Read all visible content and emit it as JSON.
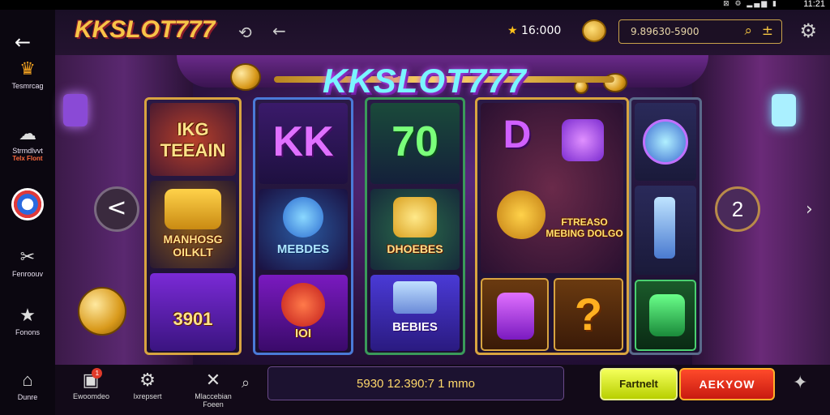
{
  "statusbar": {
    "time": "11:21",
    "icons": "⊠ ⚙ ▂▄▆ ▮"
  },
  "sidebar": {
    "items": [
      {
        "label": "Tesmrcag",
        "icon": "trophy-icon",
        "glyph": "🏆"
      },
      {
        "label": "Strmdlvvt",
        "sub": "Telx Flont",
        "icon": "cloud-icon",
        "glyph": "☁"
      },
      {
        "label": "",
        "icon": "poker-chip-icon",
        "glyph": "●"
      },
      {
        "label": "Fenroouv",
        "icon": "tools-icon",
        "glyph": "✕"
      },
      {
        "label": "Fonons",
        "icon": "star-icon",
        "glyph": "★"
      }
    ]
  },
  "header": {
    "logo": "KKSLOT777",
    "balance": "16:000",
    "search_text": "9.89630-5900"
  },
  "stage": {
    "banner_title": "KKSLOT777",
    "left_nav": "<",
    "right_nav": "2"
  },
  "reels": {
    "r1": {
      "top": "IKG TEEAIN",
      "mid": "MANHOSG OILKLT",
      "bottom": "3901"
    },
    "r2": {
      "top": "KK",
      "mid": "MEBDES",
      "bottom": "IOI"
    },
    "r3": {
      "top": "70",
      "mid": "DHOEBES",
      "bottom": "BEBIES"
    },
    "r4": {
      "top": "D",
      "mid": "FTREASO MEBING DOLGO",
      "b1": "",
      "b2": "?"
    },
    "r5": {
      "top": "",
      "mid": "",
      "bottom": ""
    }
  },
  "bottombar": {
    "items": [
      {
        "label": "Dunre",
        "icon": "home-icon"
      },
      {
        "label": "Ewoomdeo",
        "icon": "gift-icon",
        "badge": "1"
      },
      {
        "label": "Ixrepsert",
        "icon": "gear-icon"
      },
      {
        "label": "Mlaccebian Foeen",
        "icon": "tools-icon"
      }
    ],
    "bet_text": "5930 12.390:7 1 mmo",
    "btn_yellow": "Fartnelt",
    "btn_red": "AEKYOW"
  },
  "colors": {
    "accent_gold": "#f7c548",
    "accent_purple": "#8a3ad6",
    "btn_red": "#e02a18",
    "btn_yellow": "#dcef2a"
  }
}
